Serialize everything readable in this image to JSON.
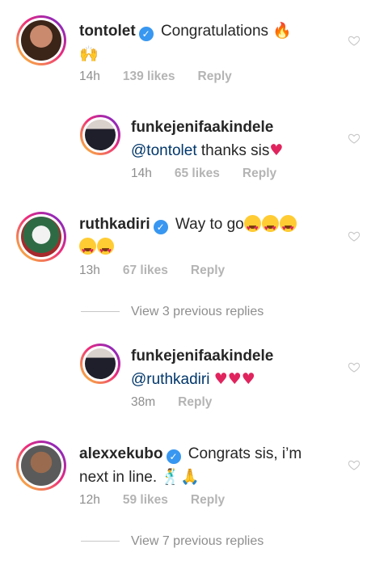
{
  "comments": [
    {
      "username": "tontolet",
      "verified": true,
      "text": "Congratulations",
      "emoji_tail": "🔥",
      "emoji_line2": "🙌",
      "time": "14h",
      "likes": "139 likes",
      "reply": "Reply"
    },
    {
      "username": "funkejenifaakindele",
      "mention": "@tontolet",
      "text": "thanks sis",
      "time": "14h",
      "likes": "65 likes",
      "reply": "Reply"
    },
    {
      "username": "ruthkadiri",
      "verified": true,
      "text": "Way to go",
      "time": "13h",
      "likes": "67 likes",
      "reply": "Reply"
    },
    {
      "username": "funkejenifaakindele",
      "mention": "@ruthkadiri",
      "time": "38m",
      "reply": "Reply"
    },
    {
      "username": "alexxekubo",
      "verified": true,
      "text": "Congrats sis, i’m",
      "text_line2": "next in line.",
      "emoji_tail": "🕺🙏",
      "time": "12h",
      "likes": "59 likes",
      "reply": "Reply"
    }
  ],
  "view_replies": [
    "View 3 previous replies",
    "View 7 previous replies"
  ],
  "colors": {
    "verified_blue": "#3897f0",
    "mention_blue": "#00376b",
    "meta_gray": "#8e8e8e",
    "heart_red": "#e0245e"
  },
  "icons": {
    "like": "heart-outline-icon",
    "verified": "verified-badge-icon"
  }
}
